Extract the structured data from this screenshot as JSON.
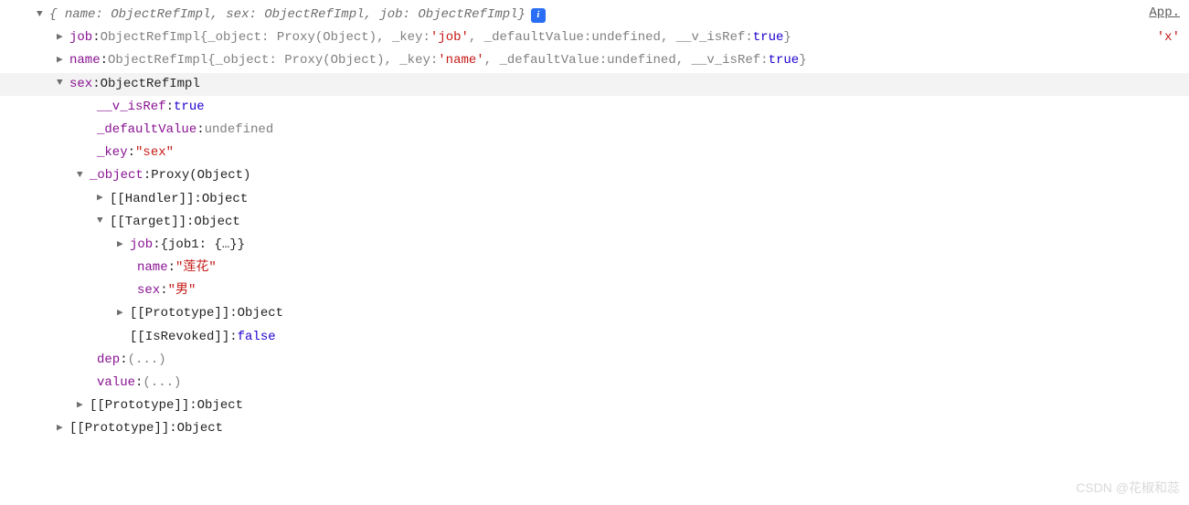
{
  "topRight": {
    "link": "App.",
    "value": "'x'"
  },
  "watermark": "CSDN @花椒和蕊",
  "infoIcon": "i",
  "summary": {
    "open": "{",
    "k1": "name:",
    "v1": "ObjectRefImpl",
    "sep": ", ",
    "k2": "sex:",
    "v2": "ObjectRefImpl",
    "k3": "job:",
    "v3": "ObjectRefImpl",
    "close": "}"
  },
  "jobLine": {
    "key": "job",
    "colon": ": ",
    "cls": "ObjectRefImpl ",
    "brace": "{_object: Proxy(Object), _key: ",
    "keyVal": "'job'",
    "mid": ", _defaultValue: ",
    "undef": "undefined",
    "mid2": ", __v_isRef: ",
    "trueVal": "true",
    "end": "}"
  },
  "nameLine": {
    "key": "name",
    "colon": ": ",
    "cls": "ObjectRefImpl ",
    "brace": "{_object: Proxy(Object), _key: ",
    "keyVal": "'name'",
    "mid": ", _defaultValue: ",
    "undef": "undefined",
    "mid2": ", __v_isRef: ",
    "trueVal": "true",
    "end": "}"
  },
  "sexHeader": {
    "key": "sex",
    "colon": ": ",
    "cls": "ObjectRefImpl"
  },
  "sex": {
    "isRefK": "__v_isRef",
    "isRefV": "true",
    "defK": "_defaultValue",
    "defV": "undefined",
    "keyK": "_key",
    "keyV": "\"sex\"",
    "objK": "_object",
    "objV": "Proxy(Object)",
    "handlerK": "[[Handler]]",
    "handlerV": "Object",
    "targetK": "[[Target]]",
    "targetV": "Object",
    "target": {
      "jobK": "job",
      "jobV": "{job1: {…}}",
      "nameK": "name",
      "nameV": "\"莲花\"",
      "sexK": "sex",
      "sexV": "\"男\"",
      "protoK": "[[Prototype]]",
      "protoV": "Object"
    },
    "revokedK": "[[IsRevoked]]",
    "revokedV": "false",
    "depK": "dep",
    "depV": "(...)",
    "valueK": "value",
    "valueV": "(...)",
    "protoK": "[[Prototype]]",
    "protoV": "Object"
  },
  "outerProtoK": "[[Prototype]]",
  "outerProtoV": "Object",
  "colon": ": "
}
